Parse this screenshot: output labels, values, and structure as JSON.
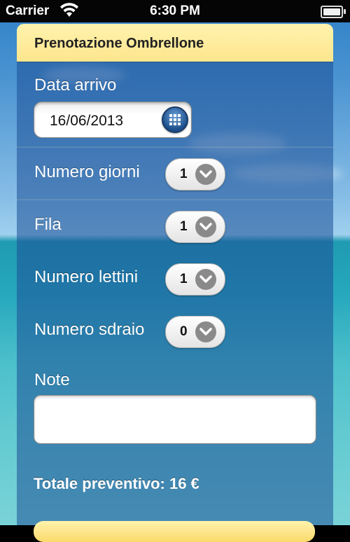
{
  "status_bar": {
    "carrier": "Carrier",
    "time": "6:30 PM"
  },
  "form": {
    "title": "Prenotazione Ombrellone",
    "date": {
      "label": "Data arrivo",
      "value": "16/06/2013",
      "icon": "calendar-icon"
    },
    "fields": [
      {
        "label": "Numero giorni",
        "value": "1"
      },
      {
        "label": "Fila",
        "value": "1"
      },
      {
        "label": "Numero lettini",
        "value": "1"
      },
      {
        "label": "Numero sdraio",
        "value": "0"
      }
    ],
    "note": {
      "label": "Note",
      "value": ""
    },
    "total": "Totale preventivo: 16 €"
  },
  "colors": {
    "header_yellow": "#fde58d",
    "panel_blue": "#1c4e96",
    "status_bar": "#050505"
  }
}
